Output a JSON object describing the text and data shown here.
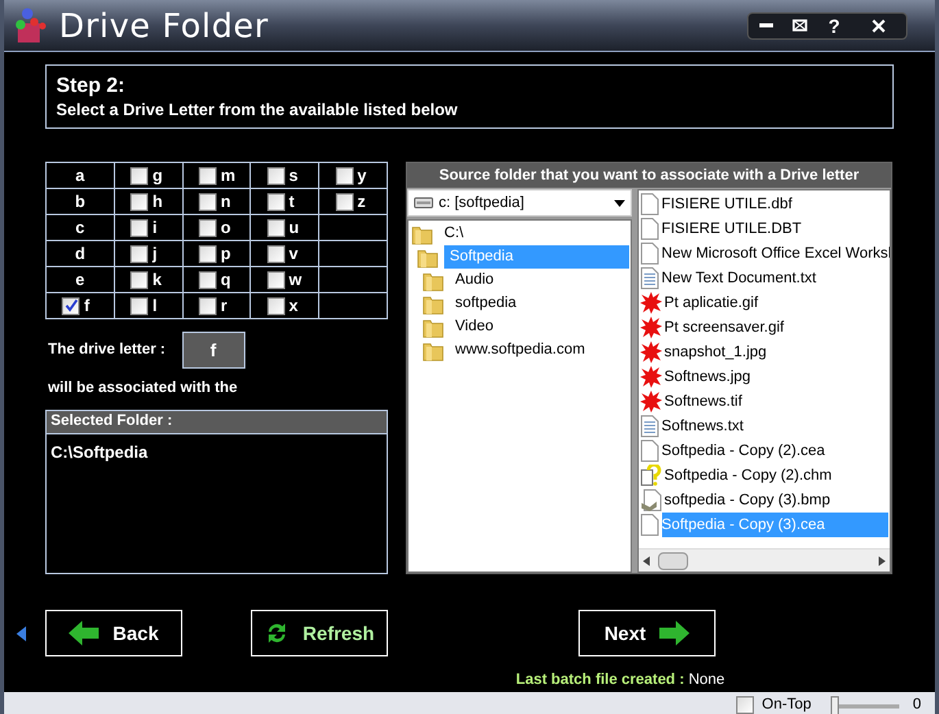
{
  "window": {
    "title": "Drive Folder",
    "help_button": "?"
  },
  "step": {
    "title": "Step 2:",
    "text": "Select a Drive Letter from the available listed below"
  },
  "drive_grid": [
    [
      {
        "letter": "a",
        "kind": "plain"
      },
      {
        "letter": "g",
        "kind": "checkbox",
        "checked": false
      },
      {
        "letter": "m",
        "kind": "checkbox",
        "checked": false
      },
      {
        "letter": "s",
        "kind": "checkbox",
        "checked": false
      },
      {
        "letter": "y",
        "kind": "checkbox",
        "checked": false
      }
    ],
    [
      {
        "letter": "b",
        "kind": "plain"
      },
      {
        "letter": "h",
        "kind": "checkbox",
        "checked": false
      },
      {
        "letter": "n",
        "kind": "checkbox",
        "checked": false
      },
      {
        "letter": "t",
        "kind": "checkbox",
        "checked": false
      },
      {
        "letter": "z",
        "kind": "checkbox",
        "checked": false
      }
    ],
    [
      {
        "letter": "c",
        "kind": "plain"
      },
      {
        "letter": "i",
        "kind": "checkbox",
        "checked": false
      },
      {
        "letter": "o",
        "kind": "checkbox",
        "checked": false
      },
      {
        "letter": "u",
        "kind": "checkbox",
        "checked": false
      }
    ],
    [
      {
        "letter": "d",
        "kind": "plain"
      },
      {
        "letter": "j",
        "kind": "checkbox",
        "checked": false
      },
      {
        "letter": "p",
        "kind": "checkbox",
        "checked": false
      },
      {
        "letter": "v",
        "kind": "checkbox",
        "checked": false
      }
    ],
    [
      {
        "letter": "e",
        "kind": "plain"
      },
      {
        "letter": "k",
        "kind": "checkbox",
        "checked": false
      },
      {
        "letter": "q",
        "kind": "checkbox",
        "checked": false
      },
      {
        "letter": "w",
        "kind": "checkbox",
        "checked": false
      }
    ],
    [
      {
        "letter": "f",
        "kind": "checkbox",
        "checked": true
      },
      {
        "letter": "l",
        "kind": "checkbox",
        "checked": false
      },
      {
        "letter": "r",
        "kind": "checkbox",
        "checked": false
      },
      {
        "letter": "x",
        "kind": "checkbox",
        "checked": false
      }
    ]
  ],
  "drive_letter": {
    "label": "The drive letter :",
    "value": "f"
  },
  "association_text": "will be associated with the",
  "selected_folder": {
    "title": "Selected Folder :",
    "value": "C:\\Softpedia"
  },
  "source": {
    "title": "Source folder that you want to associate with a Drive letter",
    "drive_combo": "c: [softpedia]",
    "tree": [
      {
        "label": "C:\\",
        "selected": false,
        "children": [
          {
            "label": "Softpedia",
            "selected": true,
            "children": [
              {
                "label": "Audio",
                "selected": false
              },
              {
                "label": "softpedia",
                "selected": false
              },
              {
                "label": "Video",
                "selected": false
              },
              {
                "label": "www.softpedia.com",
                "selected": false
              }
            ]
          }
        ]
      }
    ],
    "files": [
      {
        "name": "FISIERE UTILE.dbf",
        "kind": "blank",
        "selected": false
      },
      {
        "name": "FISIERE UTILE.DBT",
        "kind": "blank",
        "selected": false
      },
      {
        "name": "New Microsoft Office Excel Worksl",
        "kind": "blank",
        "selected": false
      },
      {
        "name": "New Text Document.txt",
        "kind": "text",
        "selected": false
      },
      {
        "name": "Pt aplicatie.gif",
        "kind": "image",
        "selected": false
      },
      {
        "name": "Pt screensaver.gif",
        "kind": "image",
        "selected": false
      },
      {
        "name": "snapshot_1.jpg",
        "kind": "image",
        "selected": false
      },
      {
        "name": "Softnews.jpg",
        "kind": "image",
        "selected": false
      },
      {
        "name": "Softnews.tif",
        "kind": "image",
        "selected": false
      },
      {
        "name": "Softnews.txt",
        "kind": "text",
        "selected": false
      },
      {
        "name": "Softpedia - Copy (2).cea",
        "kind": "blank",
        "selected": false
      },
      {
        "name": "Softpedia - Copy (2).chm",
        "kind": "help",
        "selected": false
      },
      {
        "name": "softpedia - Copy (3).bmp",
        "kind": "bitmap",
        "selected": false
      },
      {
        "name": "Softpedia - Copy (3).cea",
        "kind": "blank",
        "selected": true
      }
    ]
  },
  "buttons": [
    {
      "label": "Back",
      "kind": "back"
    },
    {
      "label": "Refresh",
      "kind": "refresh"
    },
    {
      "label": "Next",
      "kind": "next"
    }
  ],
  "last_batch": {
    "label": "Last batch file created :",
    "value": "None"
  },
  "status_bar": {
    "on_top": {
      "label": "On-Top",
      "checked": false
    },
    "slider": {
      "level": 0,
      "reading": "0"
    }
  }
}
